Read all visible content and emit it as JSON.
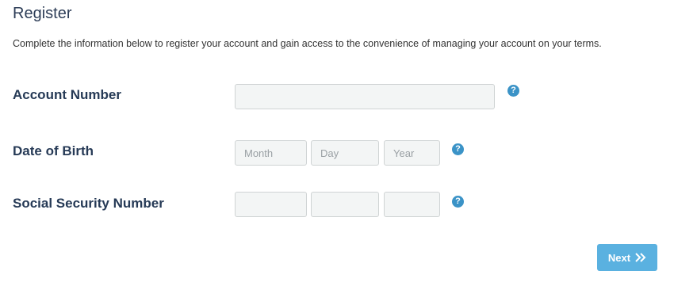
{
  "page": {
    "title": "Register",
    "description": "Complete the information below to register your account and gain access to the convenience of managing your account on your terms."
  },
  "form": {
    "account_number": {
      "label": "Account Number",
      "value": "",
      "placeholder": ""
    },
    "dob": {
      "label": "Date of Birth",
      "month": {
        "value": "",
        "placeholder": "Month"
      },
      "day": {
        "value": "",
        "placeholder": "Day"
      },
      "year": {
        "value": "",
        "placeholder": "Year"
      }
    },
    "ssn": {
      "label": "Social Security Number",
      "part1": {
        "value": "",
        "placeholder": ""
      },
      "part2": {
        "value": "",
        "placeholder": ""
      },
      "part3": {
        "value": "",
        "placeholder": ""
      }
    },
    "help_glyph": "?"
  },
  "actions": {
    "next_label": "Next",
    "next_icon": "double-chevron-right-icon"
  },
  "colors": {
    "heading": "#2d3d57",
    "help_icon": "#3b93c7",
    "button": "#5ab1e0",
    "input_bg": "#f3f5f5",
    "input_border": "#cfd3d4"
  }
}
